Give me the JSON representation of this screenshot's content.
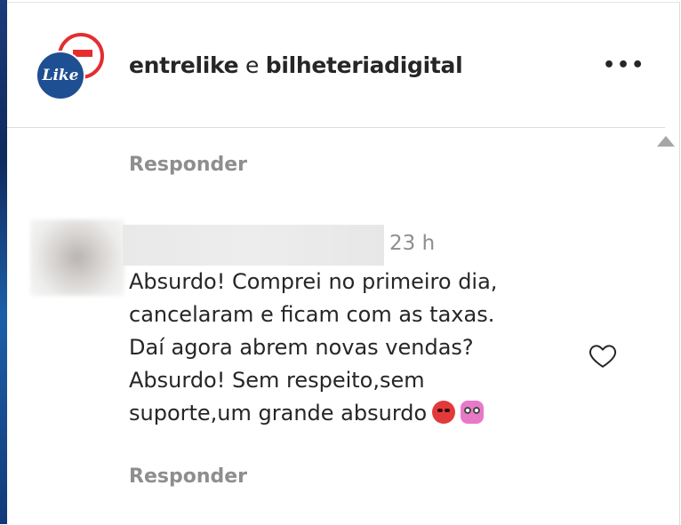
{
  "header": {
    "account_1": "entrelike",
    "connector": " e ",
    "account_2": "bilheteriadigital",
    "more_label": "•••",
    "avatar_text": "Like"
  },
  "reply_top": "Responder",
  "comment": {
    "time": "23 h",
    "text": "Absurdo! Comprei no primeiro dia,\ncancelaram e ficam com as taxas.\nDaí agora abrem novas vendas?\nAbsurdo! Sem respeito,sem\nsuporte,um grande absurdo",
    "emojis": [
      "angry-face-icon",
      "monster-face-icon"
    ],
    "reply_label": "Responder"
  },
  "colors": {
    "brand_blue": "#1f4f93",
    "brand_red": "#e52d2d",
    "secondary_text": "#8e8e8e"
  }
}
